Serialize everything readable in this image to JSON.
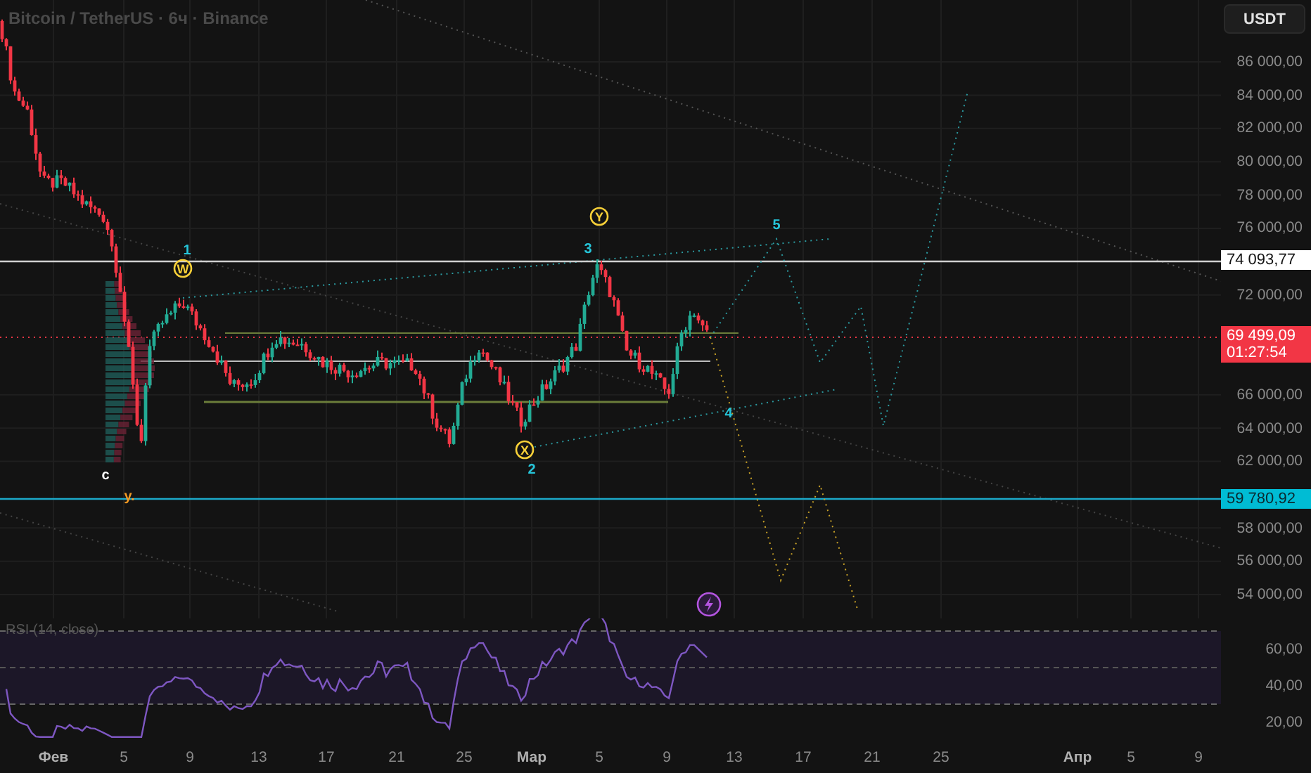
{
  "chart": {
    "title": "Bitcoin / TetherUS · 6ч · Binance",
    "currency_button": "USDT",
    "price_axis": [
      "86 000,00",
      "84 000,00",
      "82 000,00",
      "80 000,00",
      "78 000,00",
      "76 000,00",
      "72 000,00",
      "66 000,00",
      "64 000,00",
      "62 000,00",
      "58 000,00",
      "56 000,00",
      "54 000,00"
    ],
    "price_tags": [
      {
        "price": "74 093,77",
        "color": "#ffffff"
      },
      {
        "price": "69 499,09",
        "countdown": "01:27:54",
        "color": "#f23645"
      },
      {
        "price": "59 780,92",
        "color": "#00bcd4"
      }
    ],
    "wave_labels": [
      {
        "text": "1",
        "kind": "plain",
        "color": "#26c6da"
      },
      {
        "text": "W",
        "kind": "circled",
        "color": "#f7d038"
      },
      {
        "text": "3",
        "kind": "plain",
        "color": "#26c6da"
      },
      {
        "text": "Y",
        "kind": "circled",
        "color": "#f7d038"
      },
      {
        "text": "5",
        "kind": "plain",
        "color": "#26c6da"
      },
      {
        "text": "4",
        "kind": "plain",
        "color": "#26c6da"
      },
      {
        "text": "X",
        "kind": "circled",
        "color": "#f7d038"
      },
      {
        "text": "2",
        "kind": "plain",
        "color": "#26c6da"
      },
      {
        "text": "c",
        "kind": "plain",
        "color": "#ffffff"
      },
      {
        "text": "y.",
        "kind": "plain",
        "color": "#f59a23"
      }
    ]
  },
  "rsi": {
    "title": "RSI (14, close)",
    "axis": [
      "60,00",
      "40,00",
      "20,00"
    ]
  },
  "time_axis": [
    {
      "label": "Фев",
      "kind": "month"
    },
    {
      "label": "5",
      "kind": "day"
    },
    {
      "label": "9",
      "kind": "day"
    },
    {
      "label": "13",
      "kind": "day"
    },
    {
      "label": "17",
      "kind": "day"
    },
    {
      "label": "21",
      "kind": "day"
    },
    {
      "label": "25",
      "kind": "day"
    },
    {
      "label": "Мар",
      "kind": "month"
    },
    {
      "label": "5",
      "kind": "day"
    },
    {
      "label": "9",
      "kind": "day"
    },
    {
      "label": "13",
      "kind": "day"
    },
    {
      "label": "17",
      "kind": "day"
    },
    {
      "label": "21",
      "kind": "day"
    },
    {
      "label": "25",
      "kind": "day"
    },
    {
      "label": "Апр",
      "kind": "month"
    },
    {
      "label": "5",
      "kind": "day"
    },
    {
      "label": "9",
      "kind": "day"
    }
  ]
}
